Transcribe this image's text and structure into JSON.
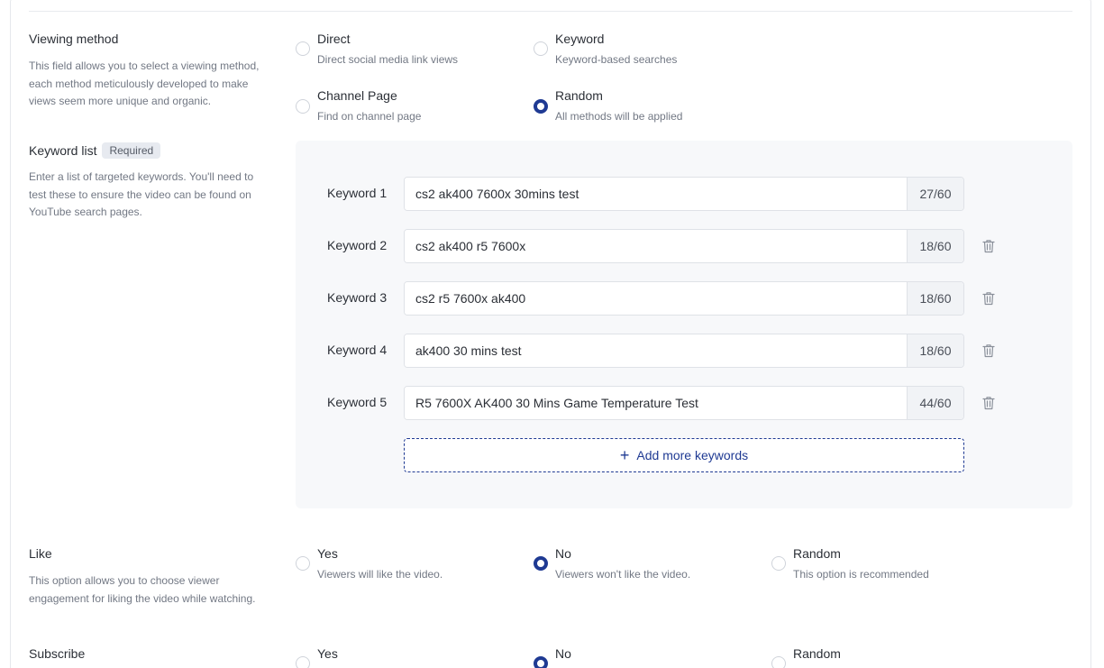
{
  "viewing": {
    "title": "Viewing method",
    "desc": "This field allows you to select a viewing method, each method meticulously developed to make views seem more unique and organic.",
    "options": [
      {
        "label": "Direct",
        "sub": "Direct social media link views",
        "checked": false
      },
      {
        "label": "Keyword",
        "sub": "Keyword-based searches",
        "checked": false
      },
      {
        "label": "Channel Page",
        "sub": "Find on channel page",
        "checked": false
      },
      {
        "label": "Random",
        "sub": "All methods will be applied",
        "checked": true
      }
    ]
  },
  "keywords": {
    "title": "Keyword list",
    "badge": "Required",
    "desc": "Enter a list of targeted keywords. You'll need to test these to ensure the video can be found on YouTube search pages.",
    "items": [
      {
        "label": "Keyword 1",
        "value": "cs2 ak400 7600x 30mins test",
        "count": "27/60"
      },
      {
        "label": "Keyword 2",
        "value": "cs2 ak400 r5 7600x",
        "count": "18/60"
      },
      {
        "label": "Keyword 3",
        "value": "cs2 r5 7600x ak400",
        "count": "18/60"
      },
      {
        "label": "Keyword 4",
        "value": "ak400 30 mins test",
        "count": "18/60"
      },
      {
        "label": "Keyword 5",
        "value": "R5 7600X AK400 30 Mins Game Temperature Test",
        "count": "44/60"
      }
    ],
    "add_label": "Add more keywords"
  },
  "like": {
    "title": "Like",
    "desc": "This option allows you to choose viewer engagement for liking the video while watching.",
    "options": [
      {
        "label": "Yes",
        "sub": "Viewers will like the video.",
        "checked": false
      },
      {
        "label": "No",
        "sub": "Viewers won't like the video.",
        "checked": true
      },
      {
        "label": "Random",
        "sub": "This option is recommended",
        "checked": false
      }
    ]
  },
  "subscribe": {
    "title": "Subscribe",
    "options": [
      {
        "label": "Yes",
        "checked": false
      },
      {
        "label": "No",
        "checked": true
      },
      {
        "label": "Random",
        "checked": false
      }
    ]
  },
  "colors": {
    "accent": "#1f3a93",
    "muted": "#727884",
    "panel": "#f7f8fa"
  },
  "icons": {
    "delete": "trash-icon",
    "add": "plus-icon"
  }
}
